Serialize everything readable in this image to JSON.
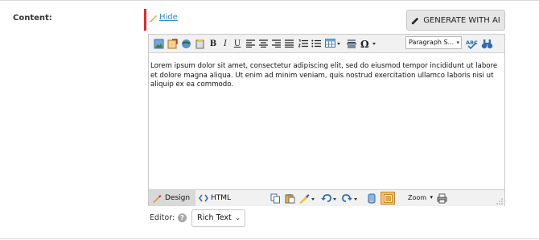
{
  "field": {
    "label": "Content:"
  },
  "hide_link": "Hide",
  "generate_button": "GENERATE WITH AI",
  "toolbar": {
    "paragraph_format": "Paragraph S...",
    "bold": "B",
    "italic": "I",
    "underline": "U"
  },
  "content": "Lorem ipsum dolor sit amet, consectetur adipiscing elit, sed do eiusmod tempor incididunt ut labore et dolore magna aliqua. Ut enim ad minim veniam, quis nostrud exercitation ullamco laboris nisi ut aliquip ex ea commodo.",
  "bottom_bar": {
    "design_tab": "Design",
    "html_tab": "HTML",
    "zoom": "Zoom"
  },
  "editor_mode": {
    "label": "Editor:",
    "help": "?",
    "selected": "Rich Text"
  },
  "colors": {
    "accent_red": "#e8262b",
    "link_blue": "#2a8fc7"
  }
}
